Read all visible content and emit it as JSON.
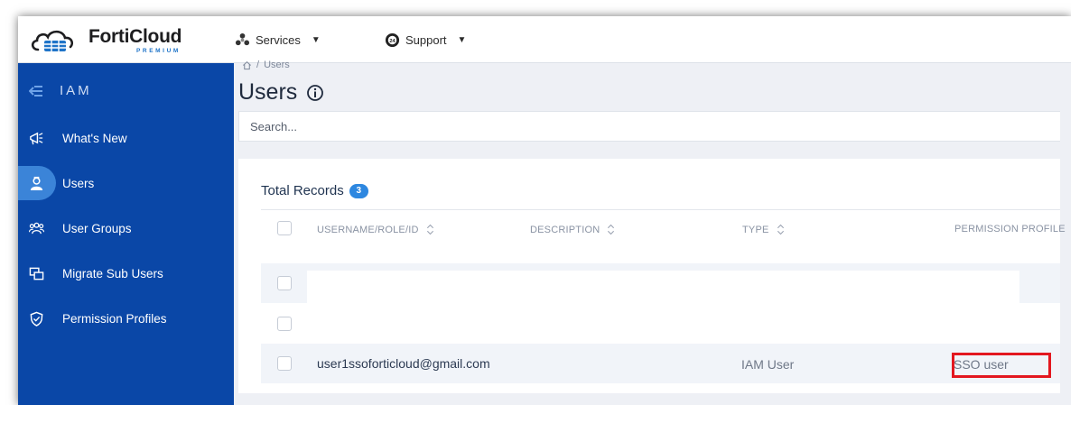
{
  "app": {
    "logo_name": "FortiCloud",
    "logo_sub": "PREMIUM",
    "brand_color": "#0a47a7",
    "accent_color": "#2d87e0"
  },
  "topnav": {
    "services_label": "Services",
    "support_label": "Support"
  },
  "sidebar": {
    "header_label": "IAM",
    "items": [
      {
        "label": "What's New",
        "icon": "megaphone-icon",
        "active": false
      },
      {
        "label": "Users",
        "icon": "user-badge-icon",
        "active": true
      },
      {
        "label": "User Groups",
        "icon": "user-group-icon",
        "active": false
      },
      {
        "label": "Migrate Sub Users",
        "icon": "migrate-icon",
        "active": false
      },
      {
        "label": "Permission Profiles",
        "icon": "shield-check-icon",
        "active": false
      }
    ]
  },
  "breadcrumb": {
    "home_icon": "home-icon",
    "separator": "/",
    "current": "Users"
  },
  "page": {
    "title": "Users"
  },
  "search": {
    "placeholder": "Search..."
  },
  "table": {
    "total_label": "Total Records",
    "total_count": "3",
    "columns": [
      "USERNAME/ROLE/ID",
      "DESCRIPTION",
      "TYPE",
      "PERMISSION PROFILE"
    ],
    "rows": [
      {
        "username": "",
        "description": "",
        "type": "",
        "permission_profile": ""
      },
      {
        "username": "",
        "description": "",
        "type": "",
        "permission_profile": ""
      },
      {
        "username": "user1ssoforticloud@gmail.com",
        "description": "",
        "type": "IAM User",
        "permission_profile": "SSO user"
      }
    ]
  },
  "highlight": {
    "color": "#e3171f"
  }
}
